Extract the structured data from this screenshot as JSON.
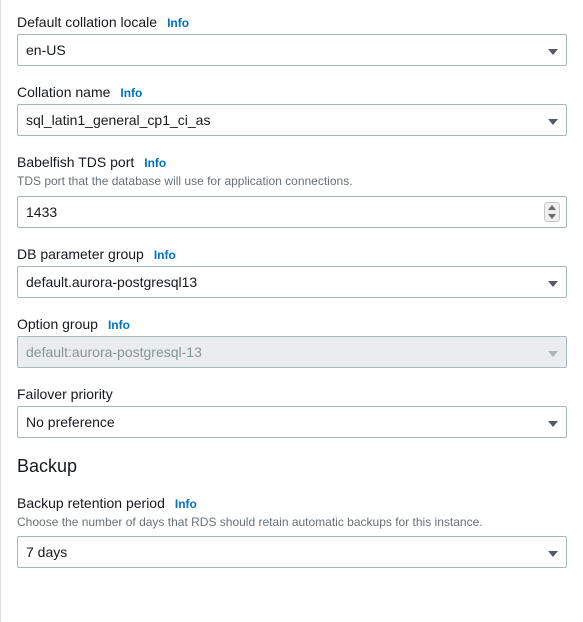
{
  "fields": {
    "collation_locale": {
      "label": "Default collation locale",
      "info": "Info",
      "value": "en-US"
    },
    "collation_name": {
      "label": "Collation name",
      "info": "Info",
      "value": "sql_latin1_general_cp1_ci_as"
    },
    "tds_port": {
      "label": "Babelfish TDS port",
      "info": "Info",
      "desc": "TDS port that the database will use for application connections.",
      "value": "1433"
    },
    "parameter_group": {
      "label": "DB parameter group",
      "info": "Info",
      "value": "default.aurora-postgresql13"
    },
    "option_group": {
      "label": "Option group",
      "info": "Info",
      "value": "default:aurora-postgresql-13"
    },
    "failover_priority": {
      "label": "Failover priority",
      "value": "No preference"
    },
    "backup_heading": "Backup",
    "backup_retention": {
      "label": "Backup retention period",
      "info": "Info",
      "desc": "Choose the number of days that RDS should retain automatic backups for this instance.",
      "value": "7 days"
    }
  }
}
